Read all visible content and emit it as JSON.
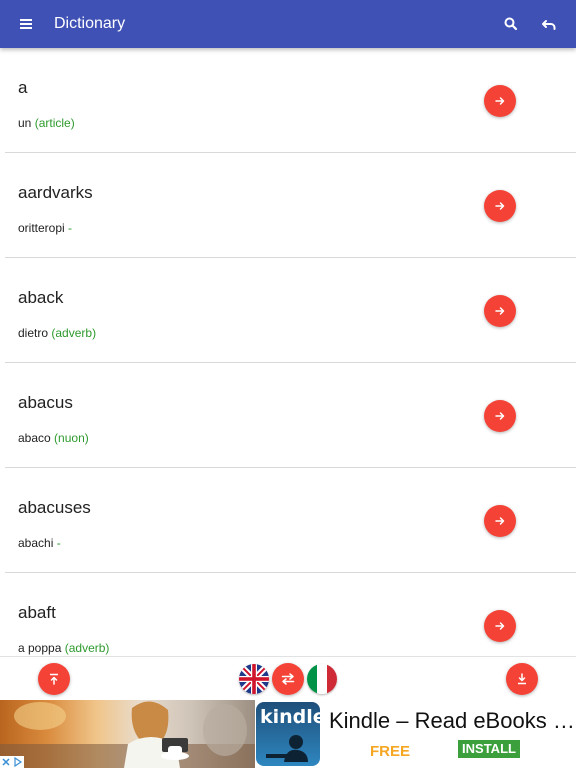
{
  "app_bar": {
    "title": "Dictionary",
    "color": "#3f51b5",
    "icons": [
      "menu-icon",
      "search-icon",
      "undo-icon"
    ]
  },
  "entries": [
    {
      "word": "a",
      "translation": "un",
      "part_of_speech": "(article)"
    },
    {
      "word": "aardvarks",
      "translation": "oritteropi",
      "part_of_speech": "-"
    },
    {
      "word": "aback",
      "translation": "dietro",
      "part_of_speech": "(adverb)"
    },
    {
      "word": "abacus",
      "translation": "abaco",
      "part_of_speech": "(nuon)"
    },
    {
      "word": "abacuses",
      "translation": "abachi",
      "part_of_speech": "-"
    },
    {
      "word": "abaft",
      "translation": "a poppa",
      "part_of_speech": "(adverb)"
    }
  ],
  "colors": {
    "accent": "#f44336",
    "part_of_speech": "#2e9a2e"
  },
  "bottom_bar": {
    "icons": [
      "scroll-top-icon",
      "uk-flag-icon",
      "swap-languages-icon",
      "italy-flag-icon",
      "scroll-bottom-icon"
    ]
  },
  "ad": {
    "logo_text": "kindle",
    "title": "Kindle – Read eBooks …",
    "price": "FREE",
    "install_label": "INSTALL",
    "colors": {
      "price": "#f5a623",
      "install": "#3ba03b"
    }
  }
}
